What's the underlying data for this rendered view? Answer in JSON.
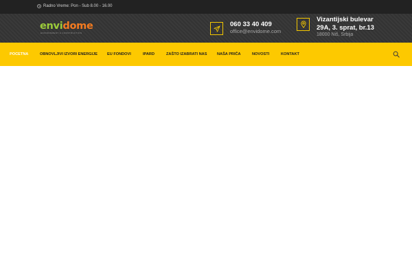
{
  "topbar": {
    "hours_text": "Radno Vreme: Pon - Sub 8.00 - 16.00",
    "clock_icon": "clock-icon"
  },
  "header": {
    "logo": {
      "word_part1": "envi",
      "word_part2": "dome",
      "tagline": "ENVIRONMENT & CONSTRUCTION"
    },
    "contact": {
      "icon": "paper-plane-icon",
      "phone": "060 33 40 409",
      "email": "office@envidome.com"
    },
    "address": {
      "icon": "map-pin-icon",
      "line1": "Vizantijski bulevar",
      "line2": "29A, 3. sprat, br.13",
      "line3": "18000 Niš, Srbija"
    }
  },
  "nav": {
    "items": [
      {
        "label": "POCETNA",
        "active": true
      },
      {
        "label": "OBNOVLJIVI IZVORI ENERGIJE",
        "active": false
      },
      {
        "label": "EU FONDOVI",
        "active": false
      },
      {
        "label": "IPARD",
        "active": false
      },
      {
        "label": "ZAŠTO IZABRATI NAS",
        "active": false
      },
      {
        "label": "NAŠA PRIČA",
        "active": false
      },
      {
        "label": "NOVOSTI",
        "active": false
      },
      {
        "label": "KONTAKT",
        "active": false
      }
    ],
    "search_icon": "search-icon"
  },
  "colors": {
    "accent": "#fdc900",
    "topbar_bg": "#222222",
    "header_bg": "#333333",
    "logo_green": "#9ccc3a",
    "logo_orange": "#f47b20"
  }
}
